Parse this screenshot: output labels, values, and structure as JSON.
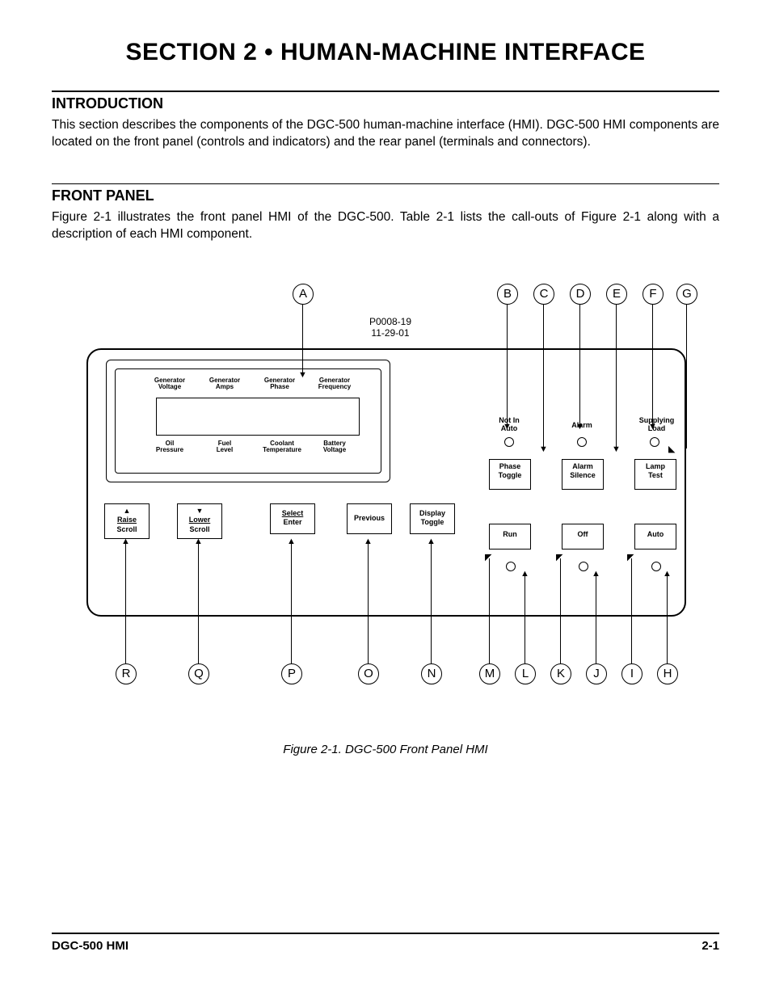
{
  "title": "SECTION 2 • HUMAN-MACHINE INTERFACE",
  "intro": {
    "heading": "INTRODUCTION",
    "body": "This section describes the components of the DGC-500 human-machine interface (HMI). DGC-500 HMI components are located on the front panel (controls and indicators) and the rear panel (terminals and connectors)."
  },
  "front": {
    "heading": "FRONT PANEL",
    "body": "Figure 2-1 illustrates the front panel HMI of the DGC-500. Table 2-1 lists the call-outs of Figure 2-1 along with a description of each HMI component."
  },
  "figure": {
    "info1": "P0008-19",
    "info2": "11-29-01",
    "lcd_top": [
      "Generator\nVoltage",
      "Generator\nAmps",
      "Generator\nPhase",
      "Generator\nFrequency"
    ],
    "lcd_bot": [
      "Oil\nPressure",
      "Fuel\nLevel",
      "Coolant\nTemperature",
      "Battery\nVoltage"
    ],
    "leds": {
      "not_in_auto": "Not In\nAuto",
      "alarm": "Alarm",
      "supplying": "Supplying\nLoad"
    },
    "btns_right_row1": {
      "phase": "Phase\nToggle",
      "silence": "Alarm\nSilence",
      "lamp": "Lamp\nTest"
    },
    "btns_right_row2": {
      "run": "Run",
      "off": "Off",
      "auto": "Auto"
    },
    "btns_bottom": {
      "raise": {
        "arrow": "▲",
        "l1": "Raise",
        "l2": "Scroll"
      },
      "lower": {
        "arrow": "▼",
        "l1": "Lower",
        "l2": "Scroll"
      },
      "select": {
        "l1": "Select",
        "l2": "Enter"
      },
      "previous": "Previous",
      "display": "Display\nToggle"
    },
    "callouts_top": [
      "A",
      "B",
      "C",
      "D",
      "E",
      "F",
      "G"
    ],
    "callouts_bot": [
      "R",
      "Q",
      "P",
      "O",
      "N",
      "M",
      "L",
      "K",
      "J",
      "I",
      "H"
    ],
    "caption": "Figure 2-1. DGC-500 Front Panel HMI"
  },
  "footer": {
    "left": "DGC-500 HMI",
    "right": "2-1"
  }
}
